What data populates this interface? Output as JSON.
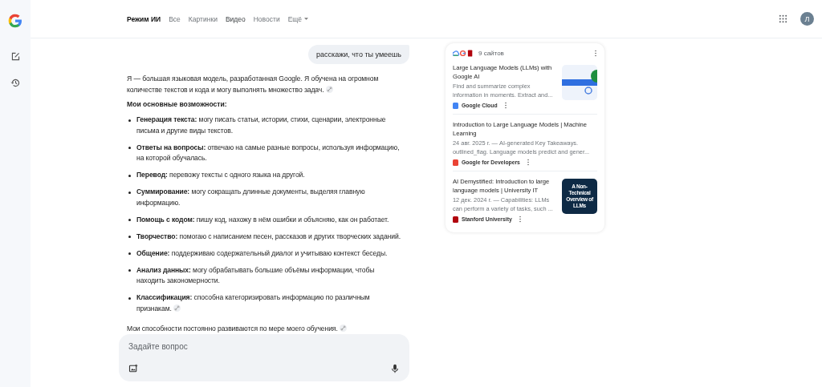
{
  "tabs": [
    {
      "label": "Режим ИИ",
      "selected": true,
      "hovered": false
    },
    {
      "label": "Все",
      "selected": false,
      "hovered": false
    },
    {
      "label": "Картинки",
      "selected": false,
      "hovered": false
    },
    {
      "label": "Видео",
      "selected": false,
      "hovered": true
    },
    {
      "label": "Новости",
      "selected": false,
      "hovered": false
    },
    {
      "label": "Ещё",
      "selected": false,
      "hovered": false,
      "dropdown": true
    }
  ],
  "account": {
    "initial": "Л"
  },
  "user_message": "расскажи, что ты умеешь",
  "answer": {
    "intro": "Я — большая языковая модель, разработанная Google. Я обучена на огромном количестве текстов и кода и могу выполнять множество задач.",
    "heading": "Мои основные возможности:",
    "items": [
      {
        "text": "**Генерация текста:** могу писать статьи, истории, стихи, сценарии, электронные письма и другие виды текстов.",
        "link": false
      },
      {
        "text": "**Ответы на вопросы:** отвечаю на самые разные вопросы, используя информацию, на которой обучалась.",
        "link": false
      },
      {
        "text": "**Перевод:** перевожу тексты с одного языка на другой.",
        "link": false
      },
      {
        "text": "**Суммирование:** могу сокращать длинные документы, выделяя главную информацию.",
        "link": false
      },
      {
        "text": "**Помощь с кодом:** пишу код, нахожу в нём ошибки и объясняю, как он работает.",
        "link": false
      },
      {
        "text": "**Творчество:** помогаю с написанием песен, рассказов и других творческих заданий.",
        "link": false
      },
      {
        "text": "**Общение:** поддерживаю содержательный диалог и учитываю контекст беседы.",
        "link": false
      },
      {
        "text": "**Анализ данных:** могу обрабатывать большие объёмы информации, чтобы находить закономерности.",
        "link": false
      },
      {
        "text": "**Классификация:** способна категоризировать информацию по различным признакам.",
        "link": true
      }
    ],
    "outro": "Мои способности постоянно развиваются по мере моего обучения."
  },
  "input": {
    "placeholder": "Задайте вопрос"
  },
  "sources": {
    "count": "9 сайтов",
    "items": [
      {
        "title": "Large Language Models (LLMs) with Google AI",
        "snippet": "Find and summarize complex information in moments. Extract and...",
        "site": "Google Cloud",
        "color": "#4285f4",
        "kind": "illustration"
      },
      {
        "title": "Introduction to Large Language Models | Machine Learning",
        "snippet": "24 авг. 2025 г. — AI-generated Key Takeaways. outlined_flag. Language models predict and gener...",
        "site": "Google for Developers",
        "color": "#ea4335",
        "kind": "plain"
      },
      {
        "title": "AI Demystified: Introduction to large language models | University IT",
        "snippet": "12 дек. 2024 г. — Capabilities: LLMs can perform a variety of tasks, such ...",
        "site": "Stanford University",
        "color": "#b1040e",
        "kind": "slide",
        "thumb_text": "A Non-Technical Overview of LLMs"
      }
    ]
  }
}
